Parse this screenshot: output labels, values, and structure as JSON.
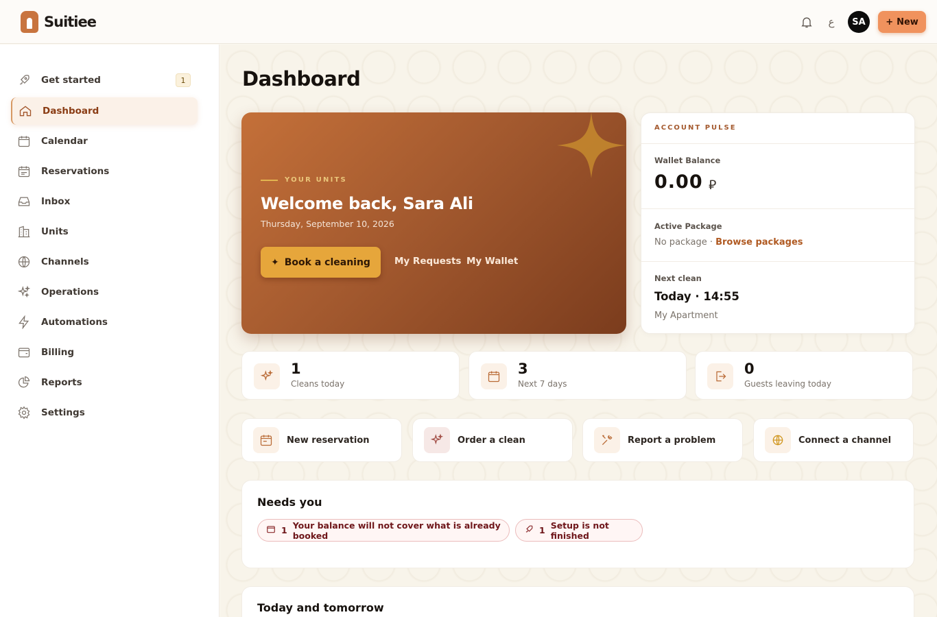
{
  "app": {
    "name": "Suitiee"
  },
  "header": {
    "lang_label": "ع",
    "avatar_initials": "SA",
    "new_label": "New"
  },
  "sidebar": {
    "items": [
      {
        "label": "Get started",
        "icon": "rocket-icon",
        "badge": "1"
      },
      {
        "label": "Dashboard",
        "icon": "home-icon",
        "active": true
      },
      {
        "label": "Calendar",
        "icon": "calendar-icon"
      },
      {
        "label": "Reservations",
        "icon": "calendar-list-icon"
      },
      {
        "label": "Inbox",
        "icon": "inbox-icon"
      },
      {
        "label": "Units",
        "icon": "building-icon"
      },
      {
        "label": "Channels",
        "icon": "globe-icon"
      },
      {
        "label": "Operations",
        "icon": "sparkles-icon"
      },
      {
        "label": "Automations",
        "icon": "lightning-icon"
      },
      {
        "label": "Billing",
        "icon": "wallet-icon"
      },
      {
        "label": "Reports",
        "icon": "pie-chart-icon"
      },
      {
        "label": "Settings",
        "icon": "gear-icon"
      }
    ]
  },
  "main": {
    "title": "Dashboard",
    "hero": {
      "eyebrow": "YOUR UNITS",
      "title": "Welcome back, Sara Ali",
      "date": "Thursday, September 10, 2026",
      "cta": "Book a cleaning",
      "link1": "My Requests",
      "link2": "My Wallet"
    },
    "pulse": {
      "heading": "ACCOUNT PULSE",
      "wallet_label": "Wallet Balance",
      "wallet_value": "0.00",
      "currency": "⃁",
      "package_label": "Active Package",
      "package_value": "No package ·",
      "package_link": "Browse packages",
      "next_label": "Next clean",
      "next_value": "Today · 14:55",
      "next_unit": "My Apartment"
    },
    "stats": [
      {
        "value": "1",
        "label": "Cleans today",
        "icon": "sparkles-icon"
      },
      {
        "value": "3",
        "label": "Next 7 days",
        "icon": "calendar-icon"
      },
      {
        "value": "0",
        "label": "Guests leaving today",
        "icon": "logout-icon"
      }
    ],
    "actions": [
      {
        "label": "New reservation",
        "icon": "calendar-icon"
      },
      {
        "label": "Order a clean",
        "icon": "sparkles-icon"
      },
      {
        "label": "Report a problem",
        "icon": "tools-icon"
      },
      {
        "label": "Connect a channel",
        "icon": "globe-icon"
      }
    ],
    "needs": {
      "title": "Needs you",
      "chips": [
        {
          "count": "1",
          "text": "Your balance will not cover what is already booked",
          "icon": "wallet-icon"
        },
        {
          "count": "1",
          "text": "Setup is not finished",
          "icon": "rocket-icon"
        }
      ]
    },
    "today": {
      "title": "Today and tomorrow"
    }
  }
}
